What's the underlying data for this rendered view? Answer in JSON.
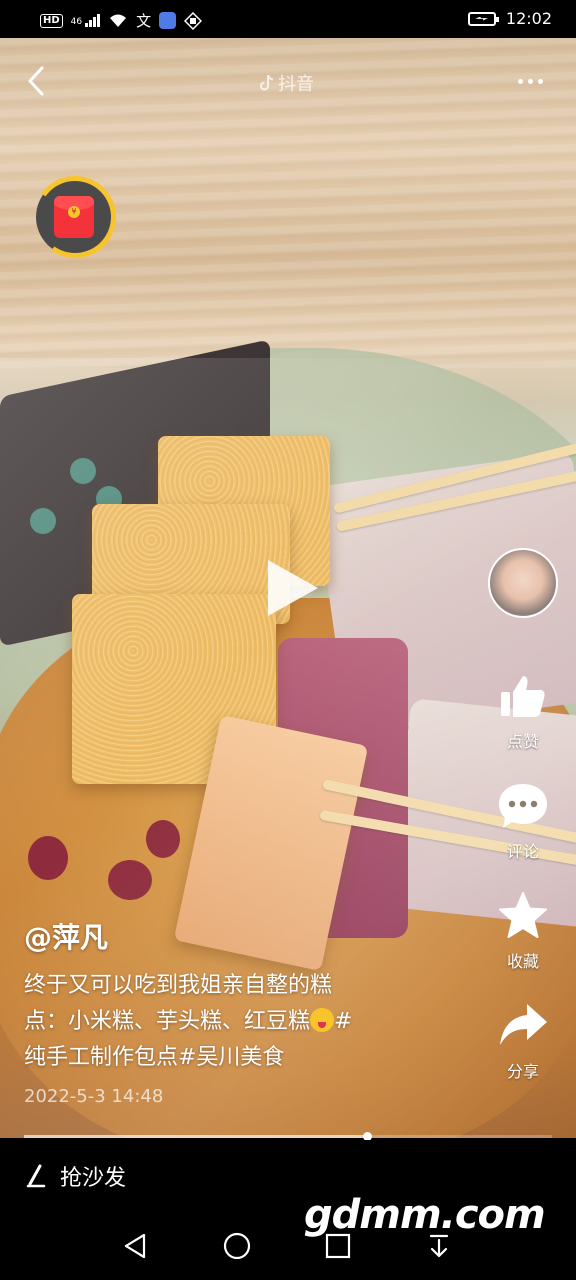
{
  "status_bar": {
    "left_icons": [
      "hd-icon",
      "signal-4g-icon",
      "wifi-icon",
      "translate-icon",
      "app-icon",
      "hand-icon"
    ],
    "hd_label": "HD",
    "network_label": "46",
    "time": "12:02"
  },
  "header": {
    "brand": "抖音"
  },
  "video": {
    "author": "@萍凡",
    "caption_line1": "终于又可以吃到我姐亲自整的糕",
    "caption_line2": "点：小米糕、芋头糕、红豆糕",
    "caption_line2_hashtag": "#",
    "caption_line3": "纯手工制作包点#吴川美食",
    "date": "2022-5-3 14:48",
    "progress": 0.65
  },
  "rail": {
    "like_label": "点赞",
    "comment_label": "评论",
    "favorite_label": "收藏",
    "share_label": "分享"
  },
  "comment_bar": {
    "placeholder": "抢沙发"
  },
  "watermark": "gdmm.com"
}
